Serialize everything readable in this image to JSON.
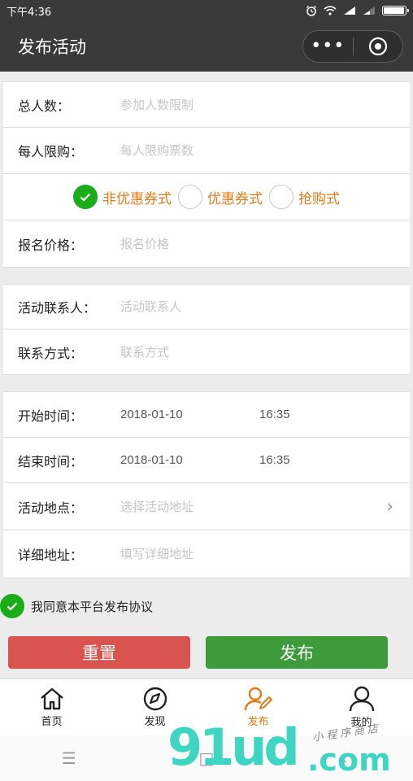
{
  "status_bar": {
    "time": "下午4:36",
    "battery_level": 1.0
  },
  "nav": {
    "title": "发布活动"
  },
  "section1": {
    "total": {
      "label": "总人数：",
      "placeholder": "参加人数限制"
    },
    "per_person": {
      "label": "每人限购：",
      "placeholder": "每人限购票数"
    },
    "ticket_types": [
      {
        "label": "非优惠券式",
        "selected": true
      },
      {
        "label": "优惠券式",
        "selected": false
      },
      {
        "label": "抢购式",
        "selected": false
      }
    ],
    "price": {
      "label": "报名价格：",
      "placeholder": "报名价格"
    }
  },
  "section2": {
    "contact": {
      "label": "活动联系人：",
      "placeholder": "活动联系人"
    },
    "phone": {
      "label": "联系方式：",
      "placeholder": "联系方式"
    }
  },
  "section3": {
    "start": {
      "label": "开始时间：",
      "date": "2018-01-10",
      "time": "16:35"
    },
    "end": {
      "label": "结束时间：",
      "date": "2018-01-10",
      "time": "16:35"
    },
    "location": {
      "label": "活动地点：",
      "placeholder": "选择活动地址"
    },
    "address": {
      "label": "详细地址：",
      "placeholder": "填写详细地址"
    }
  },
  "agree": {
    "text": "我同意本平台发布协议",
    "checked": true
  },
  "buttons": {
    "reset": "重置",
    "publish": "发布"
  },
  "tabs": [
    {
      "label": "首页",
      "icon": "home-icon",
      "active": false
    },
    {
      "label": "发现",
      "icon": "compass-icon",
      "active": false
    },
    {
      "label": "发布",
      "icon": "publish-user-icon",
      "active": true
    },
    {
      "label": "我的",
      "icon": "user-icon",
      "active": false
    }
  ],
  "watermark": {
    "logo": "91ud",
    "domain": ".com",
    "tagline": "小程序商店"
  },
  "colors": {
    "accent": "#e07b17",
    "check_green": "#1aad19",
    "reset_red": "#d9534f",
    "publish_green": "#3d9b3c",
    "nav_bg": "#3a3a3a"
  }
}
